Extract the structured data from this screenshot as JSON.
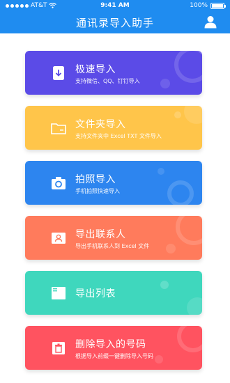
{
  "status_bar": {
    "carrier": "AT&T",
    "time": "9:41 AM",
    "battery": "100%"
  },
  "header": {
    "title": "通讯录导入助手"
  },
  "colors": {
    "header": "#1f8cf0",
    "card_fast": "#5b4be7",
    "card_folder": "#ffc54a",
    "card_photo": "#2d85ef",
    "card_export_contacts": "#ff7b5c",
    "card_export_list": "#3fd7bd",
    "card_delete": "#ff5360"
  },
  "cards": [
    {
      "label": "极速导入",
      "sub": "支持微信、QQ、钉钉导入",
      "icon": "download-phone-icon"
    },
    {
      "label": "文件夹导入",
      "sub": "支持文件夹中 Excel TXT 文件导入",
      "icon": "folder-icon"
    },
    {
      "label": "拍照导入",
      "sub": "手机拍照快速导入",
      "icon": "camera-icon"
    },
    {
      "label": "导出联系人",
      "sub": "导出手机联系人到 Excel 文件",
      "icon": "contact-card-icon"
    },
    {
      "label": "导出列表",
      "sub": "",
      "icon": "list-icon"
    },
    {
      "label": "删除导入的号码",
      "sub": "根据导入前缀一键删除导入号码",
      "icon": "trash-icon"
    }
  ]
}
